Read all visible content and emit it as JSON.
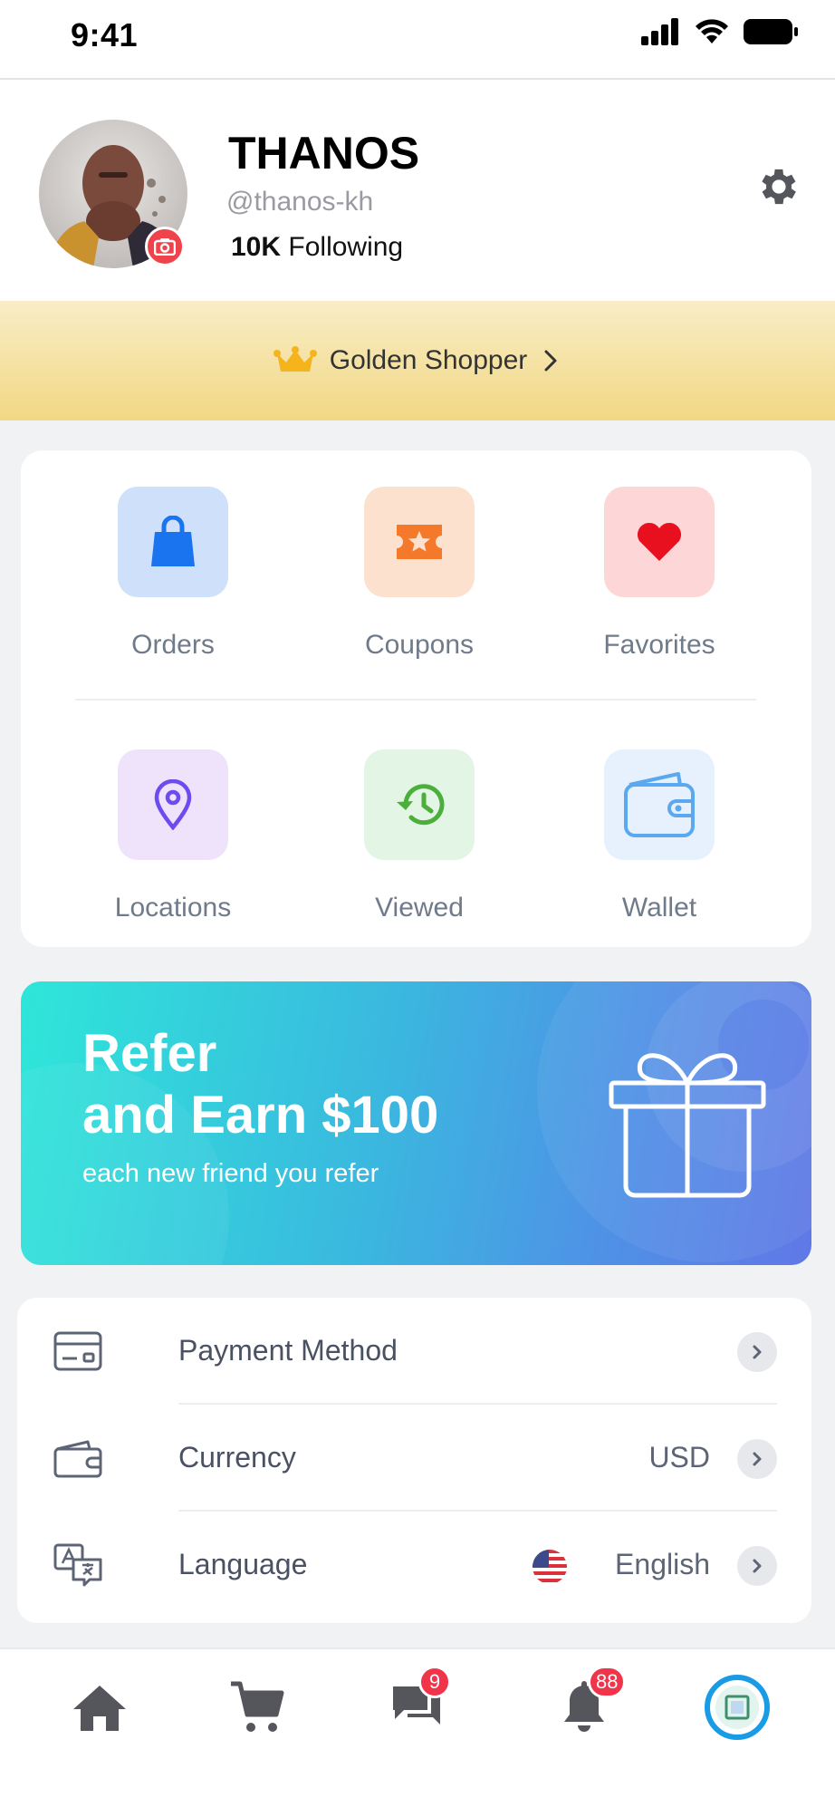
{
  "status_bar": {
    "time": "9:41"
  },
  "profile": {
    "name": "THANOS",
    "handle": "@thanos-kh",
    "following_count": "10K",
    "following_label": "Following"
  },
  "membership": {
    "label": "Golden Shopper",
    "crown_color": "#f5b31c"
  },
  "shortcuts": [
    {
      "label": "Orders",
      "icon": "shopping-bag-icon",
      "bg": "#cfe0fb",
      "color": "#1a73ef"
    },
    {
      "label": "Coupons",
      "icon": "ticket-star-icon",
      "bg": "#fde1cf",
      "color": "#f5792a"
    },
    {
      "label": "Favorites",
      "icon": "heart-icon",
      "bg": "#fdd7d7",
      "color": "#e8101e"
    },
    {
      "label": "Locations",
      "icon": "location-pin-icon",
      "bg": "#efe3fb",
      "color": "#6a4cf0"
    },
    {
      "label": "Viewed",
      "icon": "history-icon",
      "bg": "#e3f6e6",
      "color": "#4caf3c"
    },
    {
      "label": "Wallet",
      "icon": "wallet-icon",
      "bg": "#e6f1fd",
      "color": "#5aa8f0"
    }
  ],
  "referral": {
    "title_line1": "Refer",
    "title_line2": "and Earn $100",
    "subtitle": "each new friend you refer",
    "icon": "gift-icon"
  },
  "settings": {
    "payment": {
      "label": "Payment Method",
      "icon": "credit-card-icon"
    },
    "currency": {
      "label": "Currency",
      "value": "USD",
      "icon": "wallet-icon"
    },
    "language": {
      "label": "Language",
      "value": "English",
      "icon": "translate-icon",
      "flag": "us-flag-icon"
    }
  },
  "tabbar": {
    "messages_badge": "9",
    "notifications_badge": "88",
    "active_color": "#1a9be6"
  }
}
